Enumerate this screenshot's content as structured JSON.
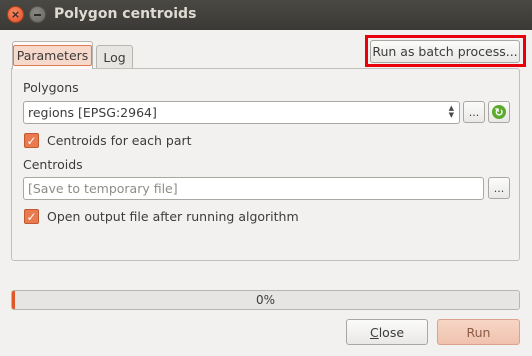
{
  "window": {
    "title": "Polygon centroids",
    "close_glyph": "×",
    "minimize_glyph": "–"
  },
  "tabs": [
    {
      "label": "Parameters",
      "selected": true
    },
    {
      "label": "Log",
      "selected": false
    }
  ],
  "batch_button": {
    "label": "Run as batch process..."
  },
  "form": {
    "polygons_label": "Polygons",
    "polygons_value": "regions [EPSG:2964]",
    "browse_label": "...",
    "centroids_each_part": {
      "label": "Centroids for each part",
      "checked": true
    },
    "centroids_label": "Centroids",
    "centroids_placeholder": "[Save to temporary file]",
    "output_browse_label": "...",
    "open_output": {
      "label": "Open output file after running algorithm",
      "checked": true
    }
  },
  "progress": {
    "value": 0,
    "text": "0%"
  },
  "buttons": {
    "close_first": "C",
    "close_rest": "lose",
    "run": "Run"
  },
  "colors": {
    "accent": "#e97a4f",
    "highlight_box": "#e8000b",
    "titlebar": "#3b3a36"
  }
}
